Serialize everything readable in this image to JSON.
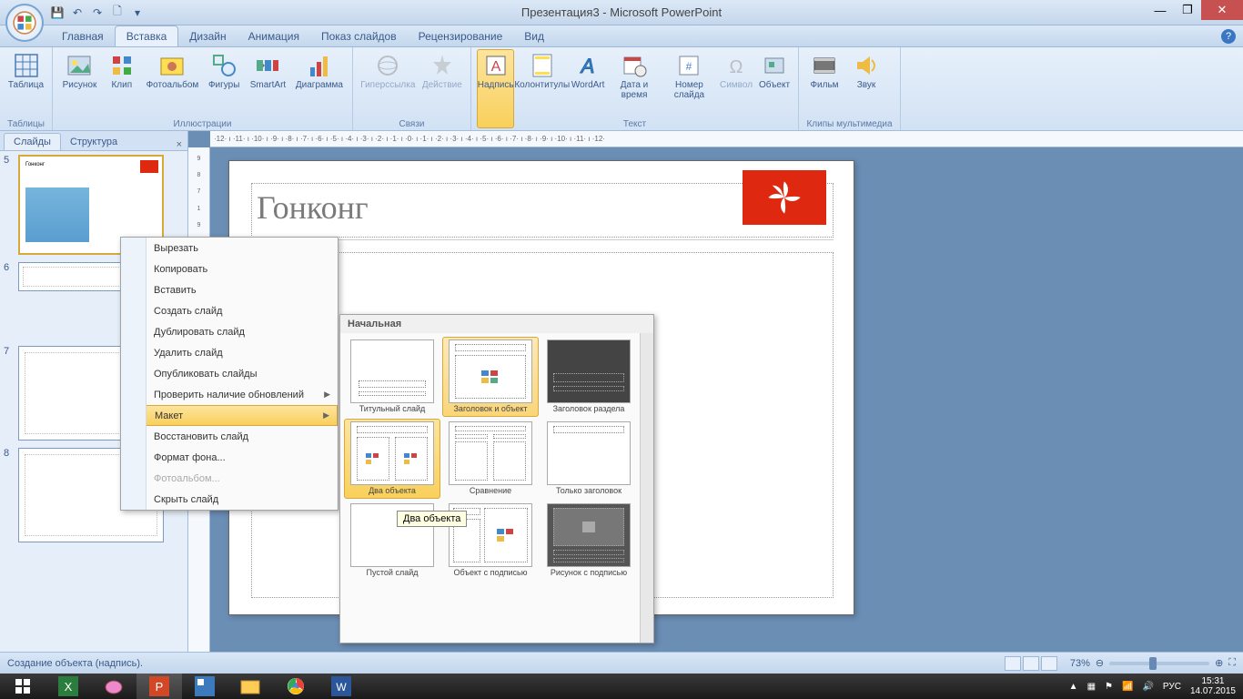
{
  "app_title": "Презентация3 - Microsoft PowerPoint",
  "tabs": {
    "home": "Главная",
    "insert": "Вставка",
    "design": "Дизайн",
    "animation": "Анимация",
    "slideshow": "Показ слайдов",
    "review": "Рецензирование",
    "view": "Вид"
  },
  "ribbon": {
    "tables": {
      "title": "Таблицы",
      "table": "Таблица"
    },
    "illustrations": {
      "title": "Иллюстрации",
      "picture": "Рисунок",
      "clip": "Клип",
      "album": "Фотоальбом",
      "shapes": "Фигуры",
      "smartart": "SmartArt",
      "chart": "Диаграмма"
    },
    "links": {
      "title": "Связи",
      "hyperlink": "Гиперссылка",
      "action": "Действие"
    },
    "text": {
      "title": "Текст",
      "textbox": "Надпись",
      "headerfooter": "Колонтитулы",
      "wordart": "WordArt",
      "datetime": "Дата и время",
      "slidenum": "Номер слайда",
      "symbol": "Символ",
      "object": "Объект"
    },
    "media": {
      "title": "Клипы мультимедиа",
      "movie": "Фильм",
      "sound": "Звук"
    }
  },
  "panel": {
    "slides": "Слайды",
    "outline": "Структура"
  },
  "thumbs": [
    "5",
    "6",
    "7",
    "8"
  ],
  "slide": {
    "title": "Гонконг"
  },
  "ruler_h": "·12· ı ·11· ı ·10· ı ·9· ı ·8· ı ·7· ı ·6· ı ·5· ı ·4· ı ·3· ı ·2· ı ·1· ı ·0· ı ·1· ı ·2· ı ·3· ı ·4· ı ·5· ı ·6· ı ·7· ı ·8· ı ·9· ı ·10· ı ·11· ı ·12·",
  "context": {
    "cut": "Вырезать",
    "copy": "Копировать",
    "paste": "Вставить",
    "newslide": "Создать слайд",
    "duplicate": "Дублировать слайд",
    "delete": "Удалить слайд",
    "publish": "Опубликовать слайды",
    "checkupd": "Проверить наличие обновлений",
    "layout": "Макет",
    "reset": "Восстановить слайд",
    "formatbg": "Формат фона...",
    "album": "Фотоальбом...",
    "hide": "Скрыть слайд"
  },
  "gallery": {
    "header": "Начальная",
    "items": [
      "Титульный слайд",
      "Заголовок и объект",
      "Заголовок раздела",
      "Два объекта",
      "Сравнение",
      "Только заголовок",
      "Пустой слайд",
      "Объект с подписью",
      "Рисунок с подписью"
    ]
  },
  "tooltip": "Два объекта",
  "status": "Создание объекта (надпись).",
  "zoom": "73%",
  "tray": {
    "lang": "РУС",
    "time": "15:31",
    "date": "14.07.2015"
  }
}
